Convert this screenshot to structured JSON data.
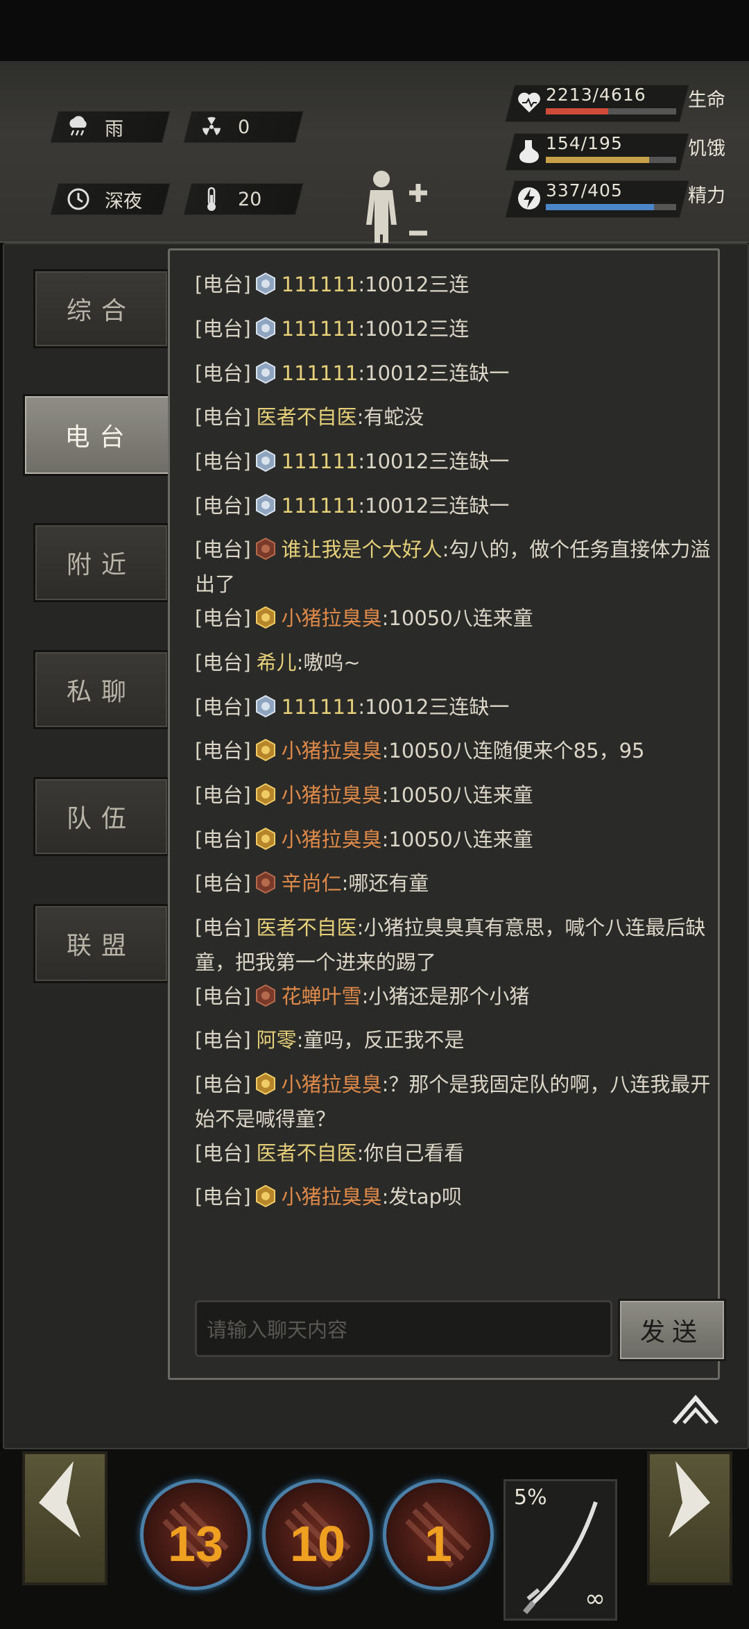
{
  "status": {
    "weather": "雨",
    "radiation": "0",
    "time_of_day": "深夜",
    "temperature": "20",
    "vitals": [
      {
        "value": "2213/4616",
        "label": "生命",
        "fraction": 0.479,
        "color": "#d04a3a",
        "icon": "heart-icon"
      },
      {
        "value": "154/195",
        "label": "饥饿",
        "fraction": 0.79,
        "color": "#c8a048",
        "icon": "stomach-icon"
      },
      {
        "value": "337/405",
        "label": "精力",
        "fraction": 0.832,
        "color": "#4a86c8",
        "icon": "energy-icon"
      }
    ]
  },
  "tabs": [
    {
      "label": "综合"
    },
    {
      "label": "电台"
    },
    {
      "label": "附近"
    },
    {
      "label": "私聊"
    },
    {
      "label": "队伍"
    },
    {
      "label": "联盟"
    }
  ],
  "active_tab": 1,
  "messages": [
    {
      "channel": "[电台]",
      "badge": "silver",
      "user": "111111",
      "user_color": "gold",
      "text": ":10012三连"
    },
    {
      "channel": "[电台]",
      "badge": "silver",
      "user": "111111",
      "user_color": "gold",
      "text": ":10012三连"
    },
    {
      "channel": "[电台]",
      "badge": "silver",
      "user": "111111",
      "user_color": "gold",
      "text": ":10012三连缺一"
    },
    {
      "channel": "[电台]",
      "badge": "",
      "user": "医者不自医",
      "user_color": "gold",
      "text": ":有蛇没"
    },
    {
      "channel": "[电台]",
      "badge": "silver",
      "user": "111111",
      "user_color": "gold",
      "text": ":10012三连缺一"
    },
    {
      "channel": "[电台]",
      "badge": "silver",
      "user": "111111",
      "user_color": "gold",
      "text": ":10012三连缺一"
    },
    {
      "channel": "[电台]",
      "badge": "bronze",
      "user": "谁让我是个大好人",
      "user_color": "gold",
      "text": ":勾八的，做个任务直接体力溢出了"
    },
    {
      "channel": "[电台]",
      "badge": "gold",
      "user": "小猪拉臭臭",
      "user_color": "orange",
      "text": ":10050八连来童"
    },
    {
      "channel": "[电台]",
      "badge": "",
      "user": "希儿",
      "user_color": "gold",
      "text": ":嗷呜~"
    },
    {
      "channel": "[电台]",
      "badge": "silver",
      "user": "111111",
      "user_color": "gold",
      "text": ":10012三连缺一"
    },
    {
      "channel": "[电台]",
      "badge": "gold",
      "user": "小猪拉臭臭",
      "user_color": "orange",
      "text": ":10050八连随便来个85，95"
    },
    {
      "channel": "[电台]",
      "badge": "gold",
      "user": "小猪拉臭臭",
      "user_color": "orange",
      "text": ":10050八连来童"
    },
    {
      "channel": "[电台]",
      "badge": "gold",
      "user": "小猪拉臭臭",
      "user_color": "orange",
      "text": ":10050八连来童"
    },
    {
      "channel": "[电台]",
      "badge": "bronze",
      "user": "辛尚仁",
      "user_color": "orange",
      "text": ":哪还有童"
    },
    {
      "channel": "[电台]",
      "badge": "",
      "user": "医者不自医",
      "user_color": "gold",
      "text": ":小猪拉臭臭真有意思，喊个八连最后缺童，把我第一个进来的踢了"
    },
    {
      "channel": "[电台]",
      "badge": "bronze",
      "user": "花蝉叶雪",
      "user_color": "orange",
      "text": ":小猪还是那个小猪"
    },
    {
      "channel": "[电台]",
      "badge": "",
      "user": "阿零",
      "user_color": "gold",
      "text": ":童吗，反正我不是"
    },
    {
      "channel": "[电台]",
      "badge": "gold",
      "user": "小猪拉臭臭",
      "user_color": "orange",
      "text": ":？那个是我固定队的啊，八连我最开始不是喊得童？"
    },
    {
      "channel": "[电台]",
      "badge": "",
      "user": "医者不自医",
      "user_color": "gold",
      "text": ":你自己看看"
    },
    {
      "channel": "[电台]",
      "badge": "gold",
      "user": "小猪拉臭臭",
      "user_color": "orange",
      "text": ":发tap呗"
    }
  ],
  "input": {
    "placeholder": "请输入聊天内容",
    "value": ""
  },
  "send_label": "发送",
  "skills": [
    {
      "count": "13",
      "icon": "claw-icon"
    },
    {
      "count": "10",
      "icon": "lightning-icon"
    },
    {
      "count": "1",
      "icon": "axe-icon"
    }
  ],
  "weapon": {
    "durability": "5%",
    "ammo": "∞",
    "icon": "katana-icon"
  },
  "colors": {
    "gold": "#e6d07a",
    "orange": "#e08a4a",
    "panel": "#262624"
  }
}
